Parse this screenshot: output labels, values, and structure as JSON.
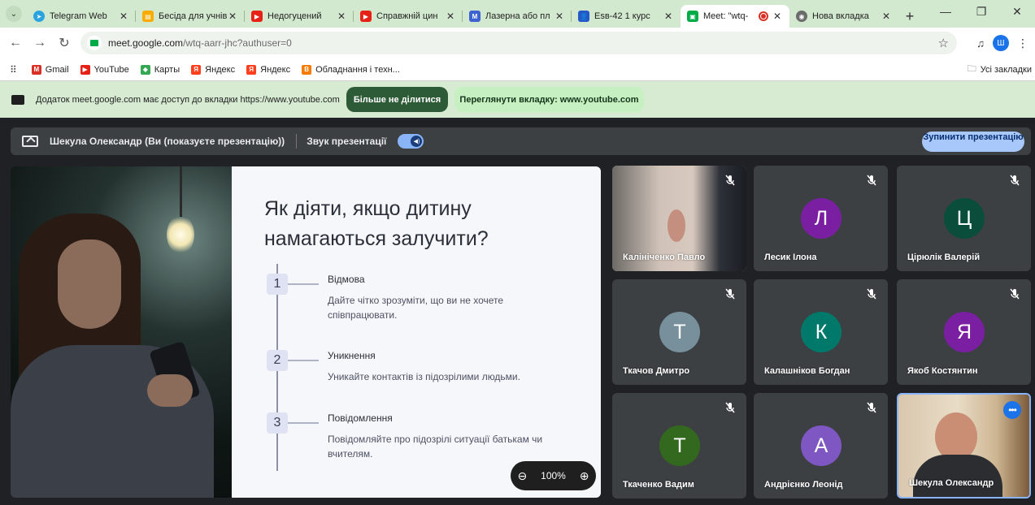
{
  "tabs": [
    {
      "title": "Telegram Web",
      "icon": "telegram-icon",
      "color": "#2aa3de"
    },
    {
      "title": "Бесіда для учнів",
      "icon": "note-icon",
      "color": "#f9ab00"
    },
    {
      "title": "Недогуцений",
      "icon": "youtube-icon",
      "color": "#e62117"
    },
    {
      "title": "Справжній цин",
      "icon": "youtube-icon",
      "color": "#e62117"
    },
    {
      "title": "Лазерна або пл",
      "icon": "docs-icon",
      "color": "#3c63d1"
    },
    {
      "title": "Esв-42 1 курс",
      "icon": "classroom-icon",
      "color": "#2458c7"
    },
    {
      "title": "Meet: \"wtq-",
      "icon": "meet-icon",
      "color": "#00ac47",
      "active": true
    },
    {
      "title": "Нова вкладка",
      "icon": "chrome-icon",
      "color": "#6b6b6b"
    }
  ],
  "address": {
    "host": "meet.google.com",
    "path": "/wtq-aarr-jhc?authuser=0"
  },
  "bookmarks": [
    {
      "label": "Gmail",
      "color": "#d93025"
    },
    {
      "label": "YouTube",
      "color": "#e62117"
    },
    {
      "label": "Карты",
      "color": "#34a853"
    },
    {
      "label": "Яндекс",
      "color": "#fc3f1d"
    },
    {
      "label": "Яндекс",
      "color": "#fc3f1d"
    },
    {
      "label": "Обладнання і техн...",
      "color": "#f57c00"
    }
  ],
  "bookmarks_all": "Усі закладки",
  "infobar": {
    "message": "Додаток meet.google.com має доступ до вкладки https://www.youtube.com",
    "stop_button": "Більше не ділитися",
    "view_button": "Переглянути вкладку: www.youtube.com"
  },
  "presbar": {
    "presenter": "Шекула Олександр (Ви (показуєте презентацію))",
    "audio_label": "Звук презентації",
    "stop_button": "Зупинити презентацію"
  },
  "slide": {
    "title": "Як діяти, якщо дитину намагаються залучити?",
    "steps": [
      {
        "num": "1",
        "title": "Відмова",
        "desc": "Дайте чітко зрозуміти, що ви не хочете співпрацювати."
      },
      {
        "num": "2",
        "title": "Уникнення",
        "desc": "Уникайте контактів із підозрілими людьми."
      },
      {
        "num": "3",
        "title": "Повідомлення",
        "desc": "Повідомляйте про підозрілі ситуації батькам чи вчителям."
      }
    ]
  },
  "zoom": {
    "level": "100%"
  },
  "participants": [
    {
      "name": "Калініченко Павло",
      "video": true
    },
    {
      "name": "Лесик Ілона",
      "initial": "Л",
      "color": "#7b1fa2"
    },
    {
      "name": "Цірюлік Валерій",
      "initial": "Ц",
      "color": "#0b4d3b"
    },
    {
      "name": "Ткачов Дмитро",
      "initial": "Т",
      "color": "#78909c"
    },
    {
      "name": "Калашніков Богдан",
      "initial": "К",
      "color": "#00796b"
    },
    {
      "name": "Якоб Костянтин",
      "initial": "Я",
      "color": "#7b1fa2"
    },
    {
      "name": "Ткаченко Вадим",
      "initial": "Т",
      "color": "#33691e"
    },
    {
      "name": "Андрієнко Леонід",
      "initial": "А",
      "color": "#7e57c2"
    },
    {
      "name": "Шекула Олександр",
      "video": true,
      "self": true
    }
  ]
}
